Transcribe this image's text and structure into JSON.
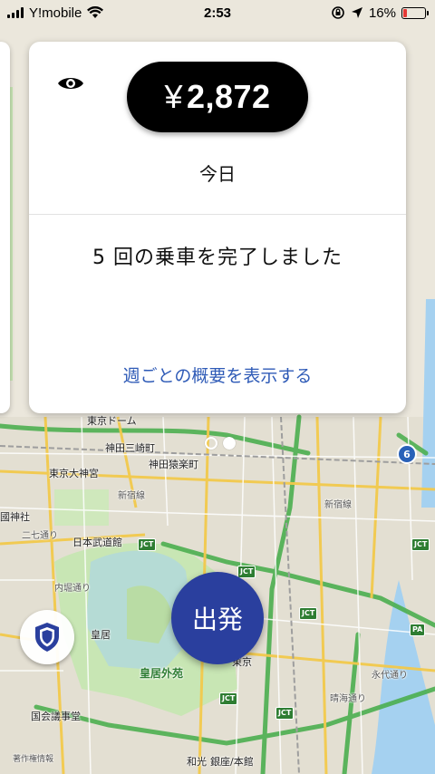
{
  "status_bar": {
    "carrier": "Y!mobile",
    "time": "2:53",
    "battery": "16%",
    "battery_level": 0.16,
    "battery_color": "#e53935"
  },
  "earnings_card": {
    "currency": "¥",
    "amount": "2,872",
    "period": "今日",
    "trips_summary": "5 回の乗車を完了しました",
    "weekly_link": "週ごとの概要を表示する",
    "link_color": "#2f5bb7",
    "visibility_icon": "eye-icon"
  },
  "pagination": {
    "count": 2,
    "active_index": 1
  },
  "go_button": {
    "label": "出発",
    "color": "#2a3f9e"
  },
  "safety_button": {
    "icon": "shield-icon"
  },
  "map": {
    "labels": {
      "kandamisaki": "神田三崎町",
      "kandasarugaku": "神田猿楽町",
      "tokyodaijingu": "東京大神宮",
      "shinjukusen": "新宿線",
      "kokujinja": "國神社",
      "nichome": "二七通り",
      "budokan": "日本武道館",
      "uchibori": "内堀通り",
      "kokyo": "皇居",
      "kokyogaien": "皇居外苑",
      "kokkai": "国会議事堂",
      "tokyo": "東京",
      "wako": "和光",
      "ginza": "銀座/本館",
      "eitai": "永代通り",
      "tokyodome": "東京ドーム",
      "shinjukusen2": "新宿線",
      "harumi": "晴海通り",
      "jct": "JCT",
      "route6": "6",
      "pa": "PA",
      "kyobashi": "著作権情報"
    }
  }
}
